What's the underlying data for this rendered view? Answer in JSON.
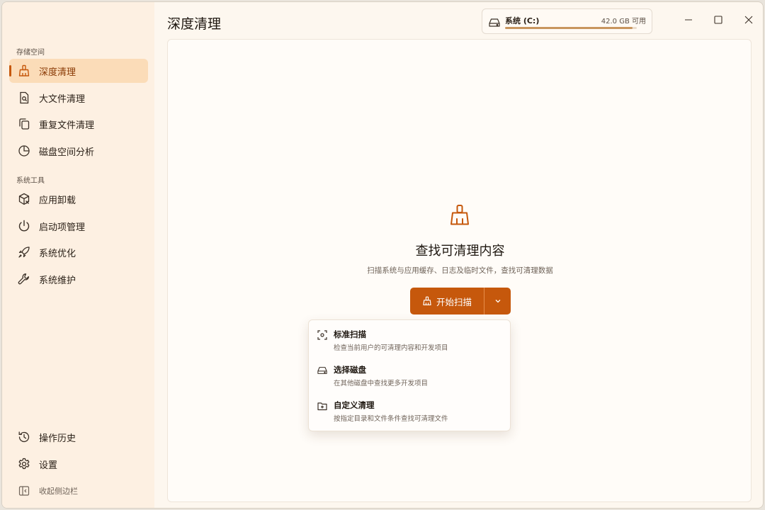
{
  "page_title": "深度清理",
  "sidebar": {
    "sections": {
      "storage": "存储空间",
      "tools": "系统工具"
    },
    "items": [
      {
        "label": "深度清理",
        "icon": "broom-icon",
        "active": true
      },
      {
        "label": "大文件清理",
        "icon": "file-search-icon"
      },
      {
        "label": "重复文件清理",
        "icon": "copy-icon"
      },
      {
        "label": "磁盘空间分析",
        "icon": "pie-chart-icon"
      },
      {
        "label": "应用卸载",
        "icon": "package-remove-icon"
      },
      {
        "label": "启动项管理",
        "icon": "power-icon"
      },
      {
        "label": "系统优化",
        "icon": "rocket-icon"
      },
      {
        "label": "系统维护",
        "icon": "wrench-icon"
      }
    ],
    "bottom_items": [
      {
        "label": "操作历史",
        "icon": "history-icon"
      },
      {
        "label": "设置",
        "icon": "gear-icon"
      }
    ],
    "collapse_label": "收起侧边栏"
  },
  "disk": {
    "name": "系统 (C:)",
    "free": "42.0 GB 可用",
    "used_fraction": 0.97,
    "icon": "drive-icon"
  },
  "window_controls": [
    "minimize-icon",
    "maximize-icon",
    "close-icon"
  ],
  "main": {
    "icon": "broom-icon",
    "title": "查找可清理内容",
    "subtitle": "扫描系统与应用缓存、日志及临时文件，查找可清理数据",
    "scan_button": "开始扫描"
  },
  "scan_menu": [
    {
      "title": "标准扫描",
      "desc": "检查当前用户的可清理内容和开发项目",
      "icon": "scan-icon"
    },
    {
      "title": "选择磁盘",
      "desc": "在其他磁盘中查找更多开发项目",
      "icon": "drive-icon"
    },
    {
      "title": "自定义清理",
      "desc": "按指定目录和文件条件查找可清理文件",
      "icon": "folder-plus-icon"
    }
  ],
  "colors": {
    "accent": "#c6580c",
    "sidebar_bg": "#fdf0e2",
    "active_bg": "#fbdcb8",
    "content_bg": "#fffcf8"
  }
}
